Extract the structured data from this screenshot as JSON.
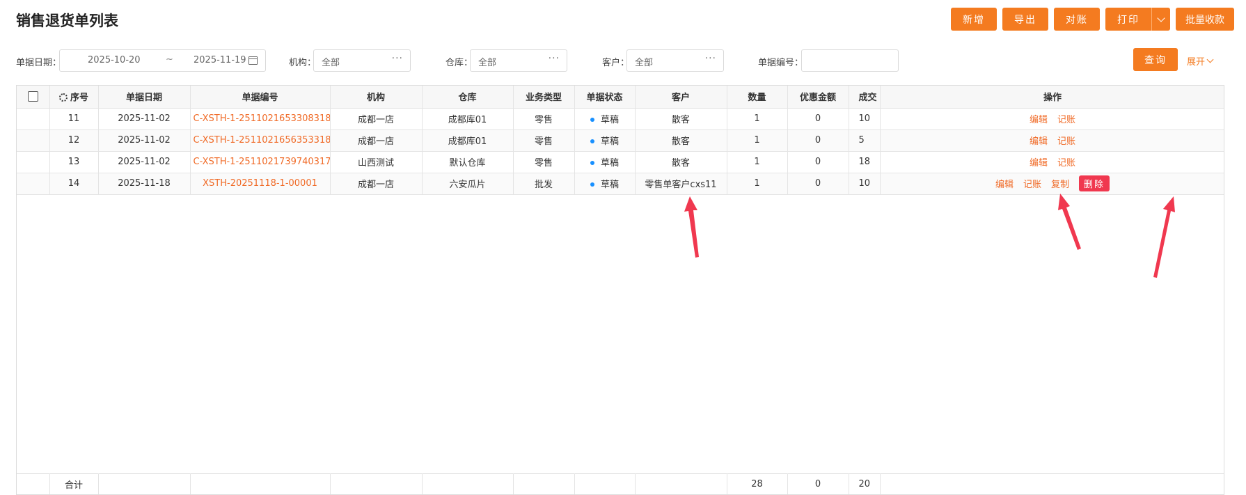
{
  "page": {
    "title": "销售退货单列表"
  },
  "toolbar": {
    "add": "新增",
    "export": "导出",
    "reconcile": "对账",
    "print": "打印",
    "batch_collect": "批量收款"
  },
  "filters": {
    "date_label": "单据日期：",
    "date_start": "2025-10-20",
    "date_sep": "~",
    "date_end": "2025-11-19",
    "org_label": "机构：",
    "org_value": "全部",
    "warehouse_label": "仓库：",
    "warehouse_value": "全部",
    "customer_label": "客户：",
    "customer_value": "全部",
    "docno_label": "单据编号：",
    "docno_value": "",
    "query_label": "查询",
    "expand_label": "展开"
  },
  "table": {
    "headers": {
      "seq": "序号",
      "date": "单据日期",
      "docno": "单据编号",
      "org": "机构",
      "warehouse": "仓库",
      "biz_type": "业务类型",
      "status": "单据状态",
      "customer": "客户",
      "qty": "数量",
      "discount": "优惠金额",
      "deal": "成交",
      "ops": "操作"
    },
    "rows": [
      {
        "seq": "11",
        "date": "2025-11-02",
        "docno": "C-XSTH-1-2511021653308318...",
        "org": "成都一店",
        "warehouse": "成都库01",
        "biz_type": "零售",
        "status": "草稿",
        "customer": "散客",
        "qty": "1",
        "discount": "0",
        "deal": "10"
      },
      {
        "seq": "12",
        "date": "2025-11-02",
        "docno": "C-XSTH-1-2511021656353318...",
        "org": "成都一店",
        "warehouse": "成都库01",
        "biz_type": "零售",
        "status": "草稿",
        "customer": "散客",
        "qty": "1",
        "discount": "0",
        "deal": "5"
      },
      {
        "seq": "13",
        "date": "2025-11-02",
        "docno": "C-XSTH-1-2511021739740317...",
        "org": "山西测试",
        "warehouse": "默认仓库",
        "biz_type": "零售",
        "status": "草稿",
        "customer": "散客",
        "qty": "1",
        "discount": "0",
        "deal": "18"
      },
      {
        "seq": "14",
        "date": "2025-11-18",
        "docno": "XSTH-20251118-1-00001",
        "org": "成都一店",
        "warehouse": "六安瓜片",
        "biz_type": "批发",
        "status": "草稿",
        "customer": "零售单客户cxs11",
        "qty": "1",
        "discount": "0",
        "deal": "10"
      }
    ],
    "ops": {
      "edit": "编辑",
      "post": "记账",
      "copy": "复制",
      "delete": "删除"
    },
    "totals": {
      "label": "合计",
      "qty": "28",
      "discount": "0",
      "deal": "20"
    }
  },
  "colors": {
    "accent": "#f47b20",
    "link": "#f06a26",
    "danger": "#f0384f",
    "status_dot": "#1890ff",
    "arrow": "#f0384f"
  }
}
